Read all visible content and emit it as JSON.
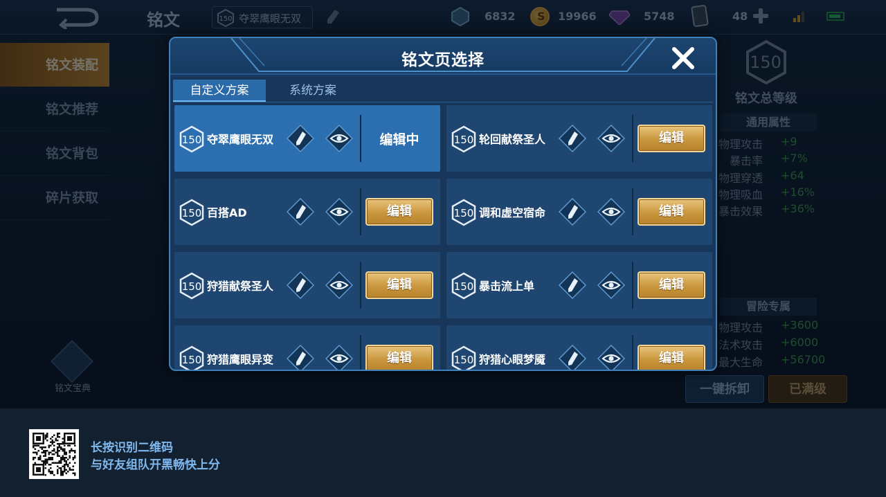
{
  "topbar": {
    "title": "铭文",
    "current_page": {
      "level": "150",
      "name": "夺翠鹰眼无双"
    },
    "currencies": [
      {
        "icon": "gem-icon",
        "value": "6832"
      },
      {
        "icon": "gold-coin-icon",
        "value": "19966"
      },
      {
        "icon": "crystal-icon",
        "value": "5748"
      },
      {
        "icon": "card-icon",
        "value": "48"
      }
    ]
  },
  "sidebar": {
    "items": [
      {
        "label": "铭文装配",
        "active": true
      },
      {
        "label": "铭文推荐",
        "active": false
      },
      {
        "label": "铭文背包",
        "active": false
      },
      {
        "label": "碎片获取",
        "active": false
      }
    ],
    "codex_label": "铭文宝典"
  },
  "right_panel": {
    "total_level": "150",
    "total_level_label": "铭文总等级",
    "general_title": "通用属性",
    "general_stats": [
      {
        "name": "物理攻击",
        "value": "+9"
      },
      {
        "name": "暴击率",
        "value": "+7%"
      },
      {
        "name": "物理穿透",
        "value": "+64"
      },
      {
        "name": "物理吸血",
        "value": "+16%"
      },
      {
        "name": "暴击效果",
        "value": "+36%"
      }
    ],
    "adventure_title": "冒险专属",
    "adventure_stats": [
      {
        "name": "物理攻击",
        "value": "+3600"
      },
      {
        "name": "法术攻击",
        "value": "+6000"
      },
      {
        "name": "最大生命",
        "value": "+56700"
      }
    ],
    "unequip_all": "一键拆卸",
    "max_level": "已满级"
  },
  "modal": {
    "title": "铭文页选择",
    "tabs": [
      {
        "label": "自定义方案",
        "active": true
      },
      {
        "label": "系统方案",
        "active": false
      }
    ],
    "edit_label": "编辑",
    "editing_label": "编辑中",
    "pages": [
      {
        "level": "150",
        "name": "夺翠鹰眼无双",
        "selected": true
      },
      {
        "level": "150",
        "name": "轮回献祭圣人",
        "selected": false
      },
      {
        "level": "150",
        "name": "百搭AD",
        "selected": false
      },
      {
        "level": "150",
        "name": "调和虚空宿命",
        "selected": false
      },
      {
        "level": "150",
        "name": "狩猎献祭圣人",
        "selected": false
      },
      {
        "level": "150",
        "name": "暴击流上单",
        "selected": false
      },
      {
        "level": "150",
        "name": "狩猎鹰眼异变",
        "selected": false
      },
      {
        "level": "150",
        "name": "狩猎心眼梦魇",
        "selected": false
      }
    ]
  },
  "footer": {
    "line1": "长按识别二维码",
    "line2": "与好友组队开黑畅快上分"
  },
  "colors": {
    "gold_button": "#c9963d",
    "selected_card": "#2c6fb0",
    "card": "#1f4670",
    "stat_value": "#3fa44d",
    "footer_text": "#7fb8ee"
  }
}
